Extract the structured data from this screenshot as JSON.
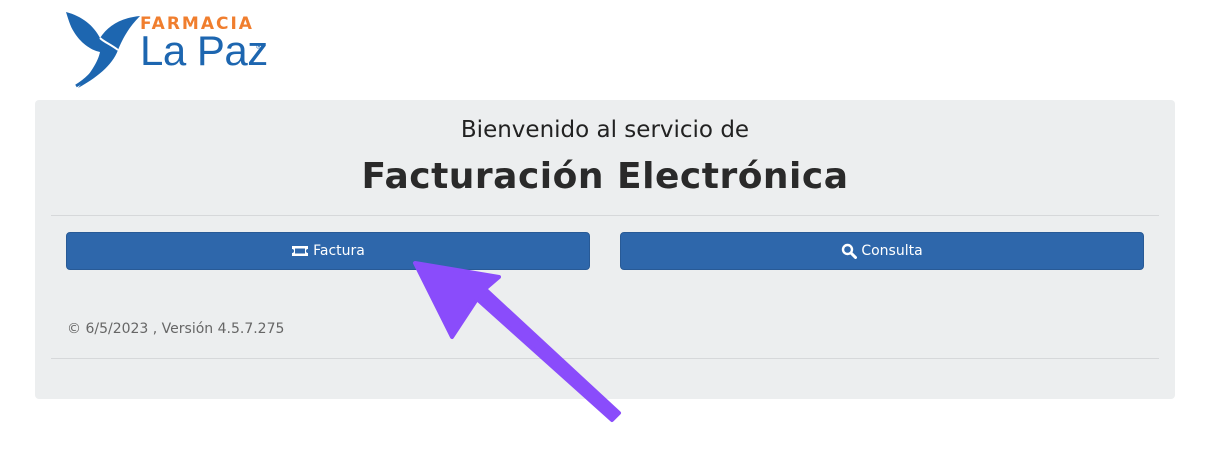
{
  "logo": {
    "farmacia": "FARMACIA",
    "brand": "La Paz",
    "registered": "®",
    "icon": "dove-icon"
  },
  "header": {
    "subtitle": "Bienvenido al servicio de",
    "title": "Facturación Electrónica"
  },
  "buttons": {
    "factura": {
      "label": "Factura",
      "icon": "ticket-icon"
    },
    "consulta": {
      "label": "Consulta",
      "icon": "search-icon"
    }
  },
  "footer": {
    "version": "© 6/5/2023 , Versión 4.5.7.275"
  },
  "annotation": {
    "icon": "arrow-pointer-icon",
    "color": "#8a4cfb"
  },
  "colors": {
    "button_bg": "#2e67ab",
    "panel_bg": "#eceeef",
    "brand_orange": "#f07e2e",
    "brand_blue": "#1d66b0"
  }
}
